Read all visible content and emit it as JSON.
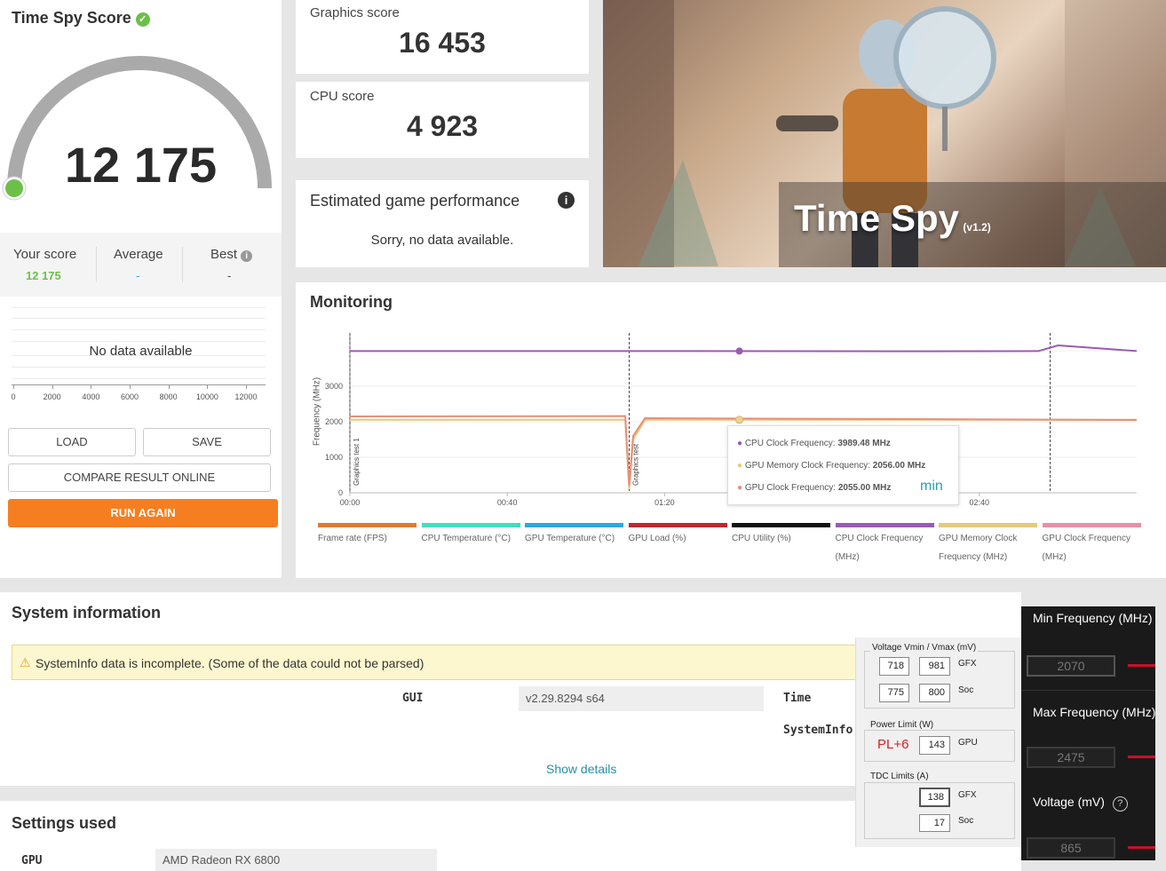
{
  "score_panel": {
    "title": "Time Spy Score",
    "score": "12 175",
    "your_score_label": "Your score",
    "your_score_value": "12 175",
    "average_label": "Average",
    "average_value": "-",
    "best_label": "Best",
    "best_value": "-",
    "no_data": "No data available",
    "x_ticks": [
      "0",
      "2000",
      "4000",
      "6000",
      "8000",
      "10000",
      "12000"
    ],
    "load_label": "LOAD",
    "save_label": "SAVE",
    "compare_label": "COMPARE RESULT ONLINE",
    "run_again_label": "RUN AGAIN",
    "accent": "#f57f20",
    "score_green": "#6cc04a"
  },
  "graphics_score": {
    "label": "Graphics score",
    "value": "16 453"
  },
  "cpu_score": {
    "label": "CPU score",
    "value": "4 923"
  },
  "game_perf": {
    "title": "Estimated game performance",
    "message": "Sorry, no data available."
  },
  "banner": {
    "title": "Time Spy",
    "version": "(v1.2)"
  },
  "monitoring": {
    "title": "Monitoring",
    "y_label": "Frequency (MHz)",
    "y_ticks": [
      "0",
      "1000",
      "2000",
      "3000"
    ],
    "x_ticks": [
      "00:00",
      "00:40",
      "01:20",
      "02:00",
      "02:40"
    ],
    "marker1": "Graphics test 1",
    "marker2": "Graphics test",
    "tooltip": {
      "cpu_label": "CPU Clock Frequency:",
      "cpu_value": "3989.48 MHz",
      "mem_label": "GPU Memory Clock Frequency:",
      "mem_value": "2056.00 MHz",
      "gpu_label": "GPU Clock Frequency:",
      "gpu_value": "2055.00 MHz",
      "min_note": "min"
    },
    "legend": [
      {
        "label": "Frame rate (FPS)",
        "color": "#e07b2e"
      },
      {
        "label": "CPU Temperature (°C)",
        "color": "#3ee0c0"
      },
      {
        "label": "GPU Temperature (°C)",
        "color": "#29a9e0"
      },
      {
        "label": "GPU Load (%)",
        "color": "#c0272d"
      },
      {
        "label": "CPU Utility (%)",
        "color": "#111111"
      },
      {
        "label": "CPU Clock Frequency (MHz)",
        "color": "#9b59b6"
      },
      {
        "label": "GPU Memory Clock Frequency (MHz)",
        "color": "#e6c97a"
      },
      {
        "label": "GPU Clock Frequency (MHz)",
        "color": "#e88fa8"
      }
    ]
  },
  "chart_data": {
    "type": "line",
    "ylabel": "Frequency (MHz)",
    "xlabel": "",
    "ylim": [
      0,
      4500
    ],
    "x_ticks": [
      "00:00",
      "00:40",
      "01:20",
      "02:00",
      "02:40"
    ],
    "series": [
      {
        "name": "CPU Clock Frequency (MHz)",
        "x_seconds": [
          0,
          70,
          145,
          175,
          180,
          200
        ],
        "values": [
          3990,
          3990,
          3985,
          3990,
          4150,
          3990
        ]
      },
      {
        "name": "GPU Memory Clock Frequency (MHz)",
        "x_seconds": [
          0,
          70,
          71,
          72,
          75,
          200
        ],
        "values": [
          2056,
          2056,
          100,
          1500,
          2056,
          2056
        ]
      },
      {
        "name": "GPU Clock Frequency (MHz)",
        "x_seconds": [
          0,
          70,
          71,
          72,
          75,
          200
        ],
        "values": [
          2150,
          2160,
          200,
          1600,
          2100,
          2050
        ]
      }
    ]
  },
  "system_info": {
    "title": "System information",
    "warning": "SystemInfo data is incomplete. (Some of the data could not be parsed)",
    "gui_label": "GUI",
    "gui_value": "v2.29.8294 s64",
    "time_label": "Time",
    "systeminfo_label": "SystemInfo",
    "show_details": "Show details"
  },
  "settings": {
    "title": "Settings used",
    "gpu_label": "GPU",
    "gpu_value": "AMD Radeon RX 6800"
  },
  "tuner": {
    "voltage_title": "Voltage Vmin / Vmax (mV)",
    "gfx_min": "718",
    "gfx_max": "981",
    "gfx_label": "GFX",
    "soc_min": "775",
    "soc_max": "800",
    "soc_label": "Soc",
    "power_title": "Power Limit (W)",
    "pl_note": "PL+6",
    "power_value": "143",
    "power_label": "GPU",
    "tdc_title": "TDC Limits (A)",
    "tdc_gfx": "138",
    "tdc_gfx_label": "GFX",
    "tdc_soc": "17",
    "tdc_soc_label": "Soc"
  },
  "amd": {
    "min_freq_label": "Min Frequency (MHz)",
    "min_freq_value": "2070",
    "max_freq_label": "Max Frequency (MHz)",
    "max_freq_value": "2475",
    "voltage_label": "Voltage (mV)",
    "voltage_value": "865"
  }
}
